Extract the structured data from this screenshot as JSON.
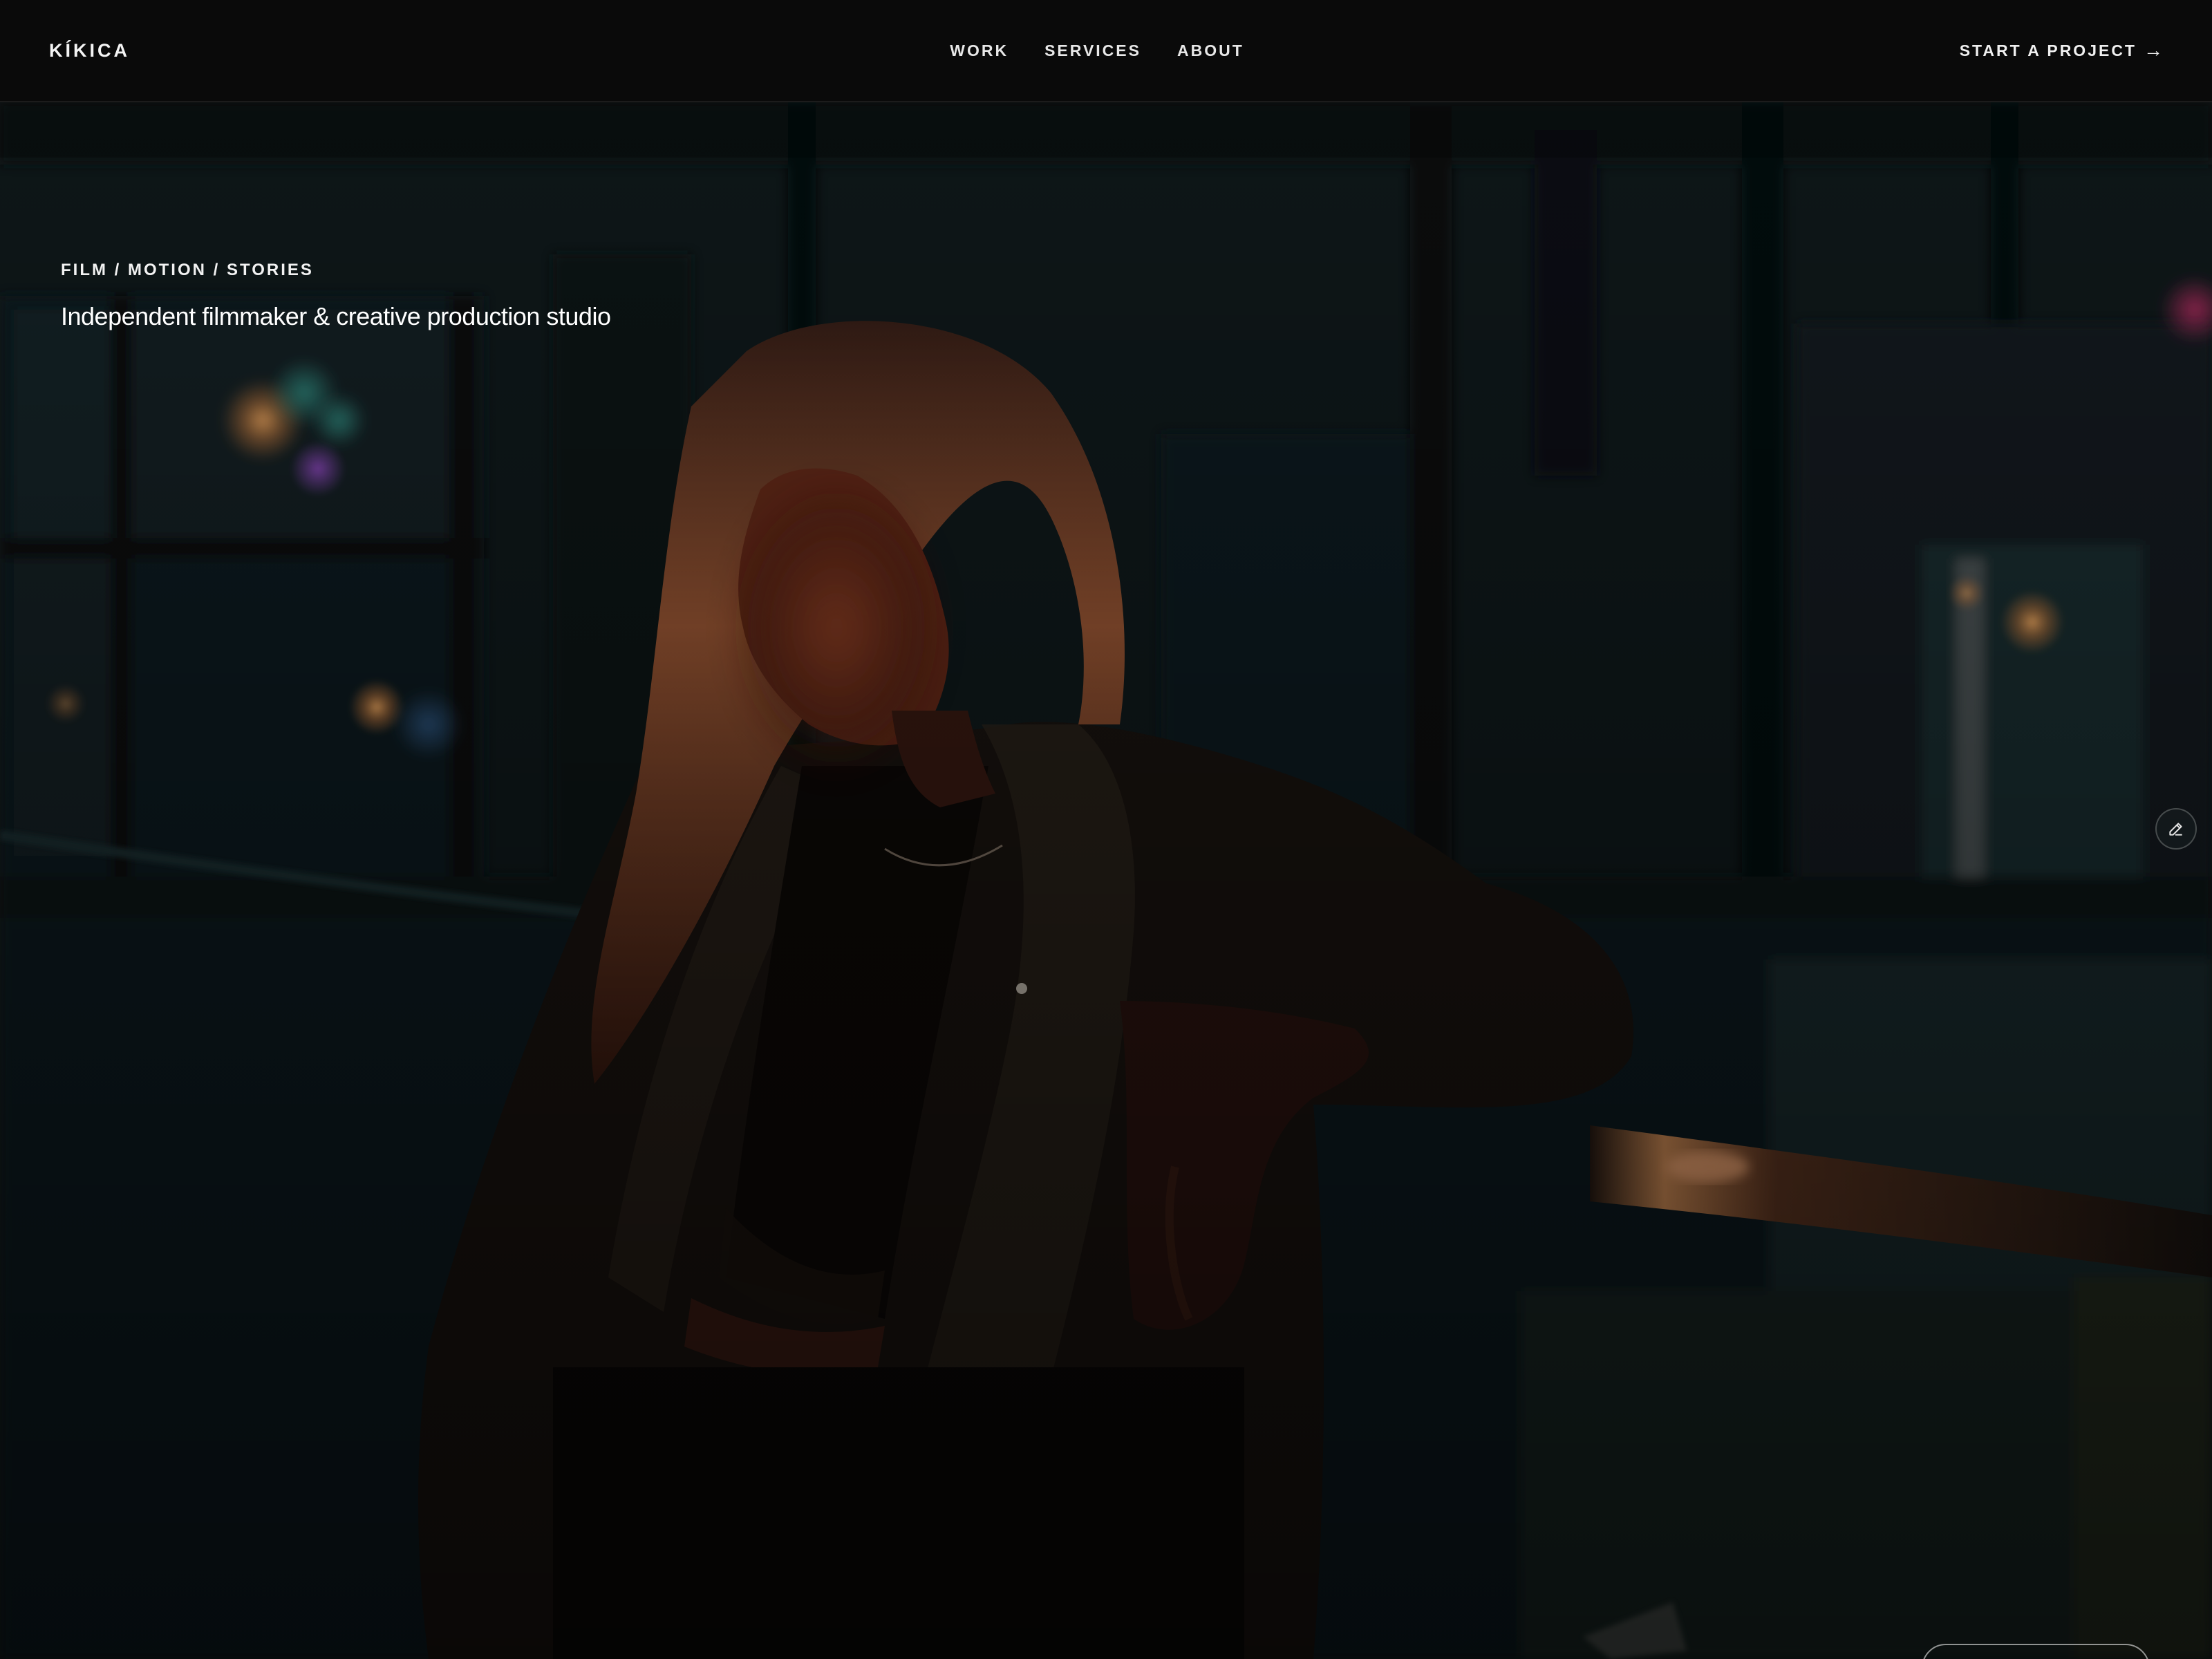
{
  "header": {
    "brand": "KÍKICA",
    "nav": [
      {
        "label": "WORK"
      },
      {
        "label": "SERVICES"
      },
      {
        "label": "ABOUT"
      }
    ],
    "cta_label": "START A PROJECT",
    "cta_icon": "arrow-right-icon"
  },
  "hero": {
    "eyebrow": "FILM / MOTION / STORIES",
    "tagline": "Independent filmmaker & creative production studio",
    "image": "woman-on-night-balcony",
    "edit_icon": "pencil-icon"
  },
  "colors": {
    "background": "#0a0a0a",
    "text": "#f2f2f2",
    "hero_shadow": "#0c1416",
    "warm_glow": "#d4713a"
  }
}
